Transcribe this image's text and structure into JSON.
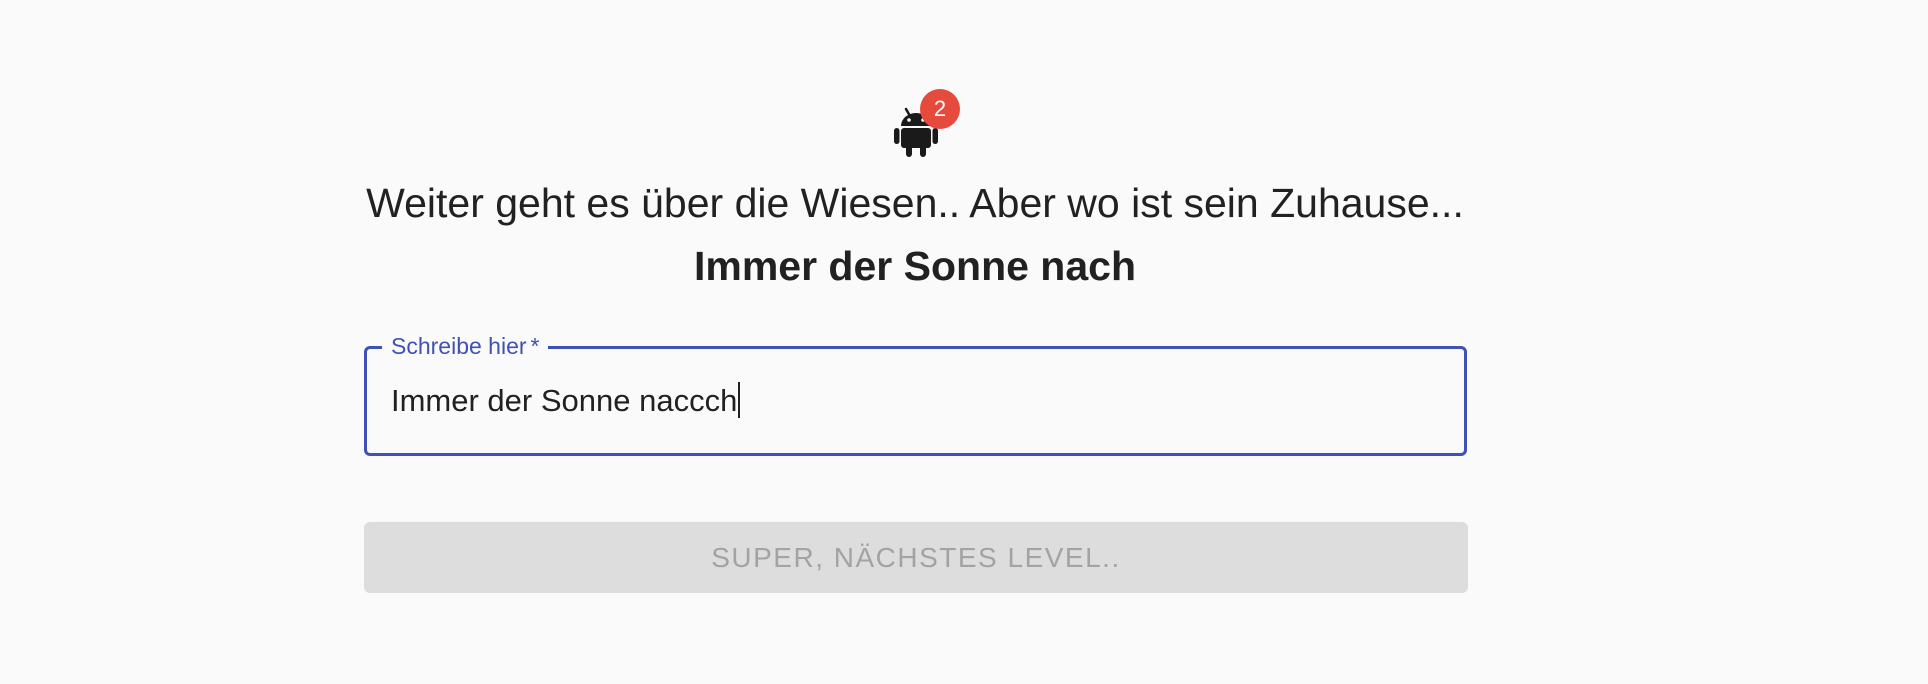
{
  "header": {
    "icon": "android-icon",
    "badge_count": "2",
    "badge_color": "#e64a3d",
    "subtitle": "Weiter geht es über die Wiesen.. Aber wo ist sein Zuhause...",
    "title": "Immer der Sonne nach"
  },
  "answer_field": {
    "label": "Schreibe hier",
    "required_marker": "*",
    "value": "Immer der Sonne naccch",
    "accent_color": "#3f51b5"
  },
  "next_button": {
    "label": "SUPER, NÄCHSTES LEVEL..",
    "disabled": true
  }
}
